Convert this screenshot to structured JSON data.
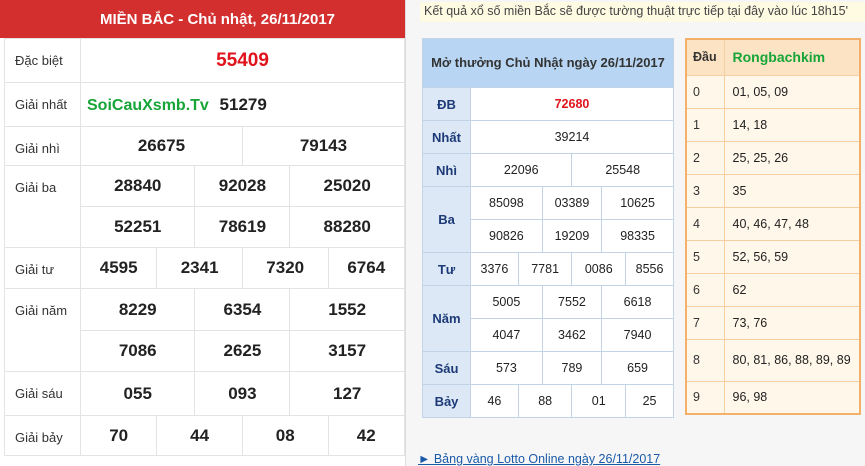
{
  "left": {
    "header": "MIỀN BẮC - Chủ nhật, 26/11/2017",
    "labels": {
      "db": "Đặc biệt",
      "g1": "Giải nhất",
      "g2": "Giải nhì",
      "g3": "Giải ba",
      "g4": "Giải tư",
      "g5": "Giải năm",
      "g6": "Giải sáu",
      "g7": "Giải bảy"
    },
    "site_name": "SoiCauXsmb.Tv",
    "db": "55409",
    "g1": "51279",
    "g2": [
      "26675",
      "79143"
    ],
    "g3": [
      "28840",
      "92028",
      "25020",
      "52251",
      "78619",
      "88280"
    ],
    "g4": [
      "4595",
      "2341",
      "7320",
      "6764"
    ],
    "g5": [
      "8229",
      "6354",
      "1552",
      "7086",
      "2625",
      "3157"
    ],
    "g6": [
      "055",
      "093",
      "127"
    ],
    "g7": [
      "70",
      "44",
      "08",
      "42"
    ]
  },
  "right": {
    "notice": "Kết quả xổ số miền Bắc sẽ được tường thuật trực tiếp tại đây vào lúc 18h15'",
    "mid": {
      "header": "Mở thưởng Chủ Nhật ngày 26/11/2017",
      "labels": {
        "db": "ĐB",
        "g1": "Nhất",
        "g2": "Nhì",
        "g3": "Ba",
        "g4": "Tư",
        "g5": "Năm",
        "g6": "Sáu",
        "g7": "Bảy"
      },
      "db": "72680",
      "g1": "39214",
      "g2": [
        "22096",
        "25548"
      ],
      "g3": [
        "85098",
        "03389",
        "10625",
        "90826",
        "19209",
        "98335"
      ],
      "g4": [
        "3376",
        "7781",
        "0086",
        "8556"
      ],
      "g5": [
        "5005",
        "7552",
        "6618",
        "4047",
        "3462",
        "7940"
      ],
      "g6": [
        "573",
        "789",
        "659"
      ],
      "g7": [
        "46",
        "88",
        "01",
        "25"
      ]
    },
    "dau": {
      "head_label": "Đầu",
      "brand": "Rongbachkim",
      "rows": [
        {
          "d": "0",
          "v": "01, 05, 09"
        },
        {
          "d": "1",
          "v": "14, 18"
        },
        {
          "d": "2",
          "v": "25, 25, 26"
        },
        {
          "d": "3",
          "v": "35"
        },
        {
          "d": "4",
          "v": "40, 46, 47, 48"
        },
        {
          "d": "5",
          "v": "52, 56, 59"
        },
        {
          "d": "6",
          "v": "62"
        },
        {
          "d": "7",
          "v": "73, 76"
        },
        {
          "d": "8",
          "v": "80, 81, 86, 88, 89, 89"
        },
        {
          "d": "9",
          "v": "96, 98"
        }
      ]
    },
    "link": "► Bảng vàng Lotto Online ngày 26/11/2017"
  }
}
